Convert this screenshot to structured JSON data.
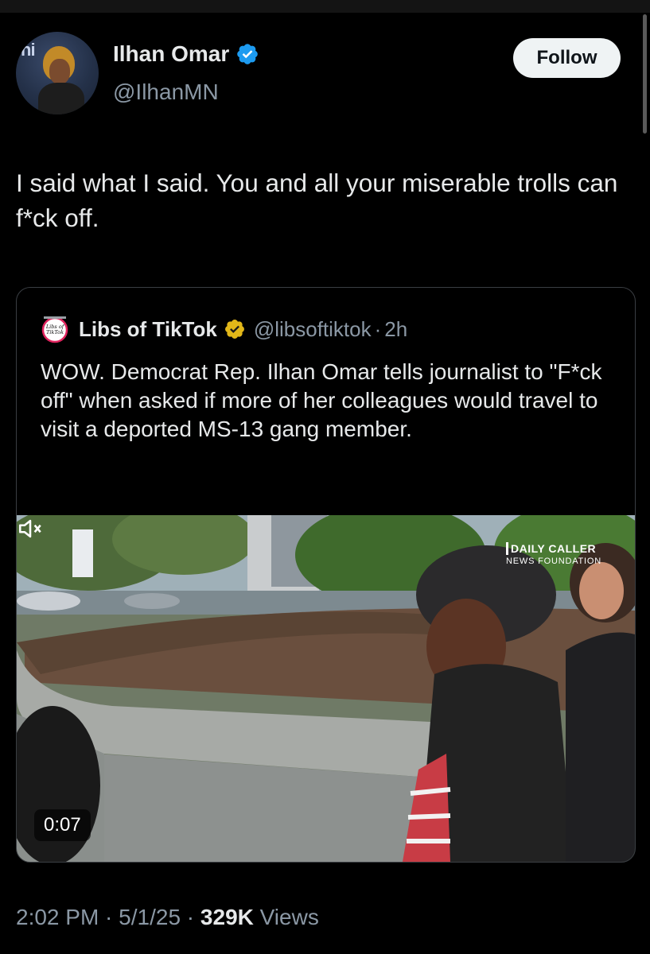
{
  "author": {
    "name": "Ilhan Omar",
    "handle": "@IlhanMN",
    "avatar_icon": "profile-photo",
    "verified_color": "#1d9bf0"
  },
  "follow_label": "Follow",
  "tweet_text": "I said what I said. You and all your miserable trolls can f*ck off.",
  "quote": {
    "name": "Libs of TikTok",
    "handle": "@libsoftiktok",
    "separator": "·",
    "time": "2h",
    "logo_text": "Libs of TikTok",
    "badge_color": "#e2b719",
    "text": "WOW. Democrat Rep. Ilhan Omar tells journalist to \"F*ck off\" when asked if more of her colleagues would travel to visit a deported MS-13 gang member.",
    "video": {
      "duration": "0:07",
      "watermark_line1": "DAILY CALLER",
      "watermark_line2": "NEWS FOUNDATION",
      "mute_icon": "speaker-muted-icon"
    }
  },
  "footer": {
    "time": "2:02 PM",
    "sep1": " · ",
    "date": "5/1/25",
    "sep2": " · ",
    "views_count": "329K",
    "views_label": " Views"
  }
}
